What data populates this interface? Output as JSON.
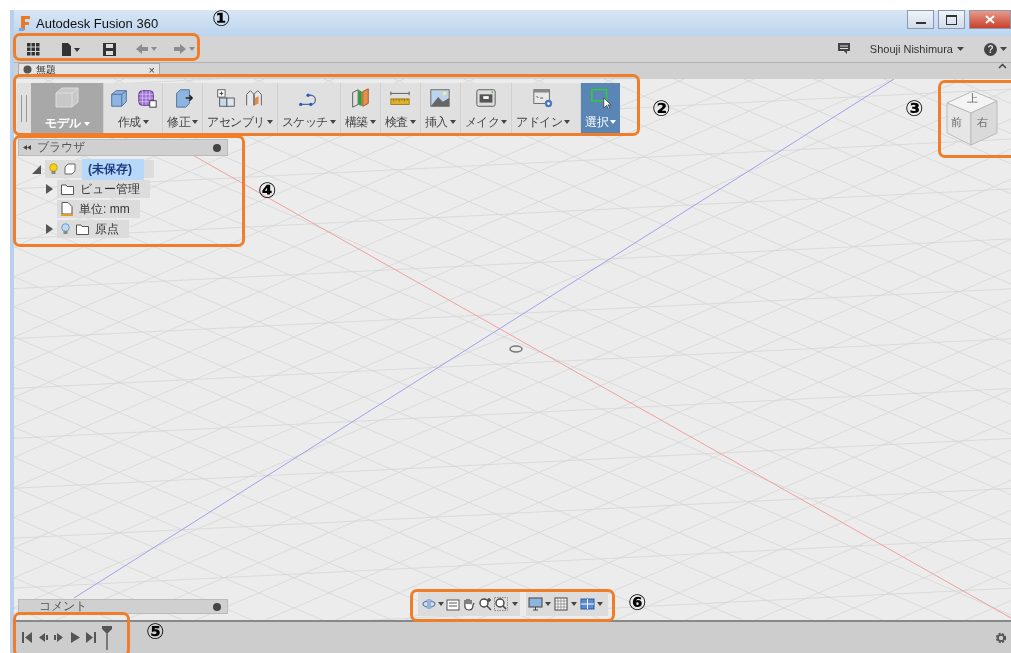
{
  "window": {
    "title": "Autodesk Fusion 360"
  },
  "quick_access": [
    {
      "kind": "apps",
      "disabled": false
    },
    {
      "kind": "file",
      "disabled": false
    },
    {
      "kind": "save",
      "disabled": false
    },
    {
      "kind": "undo",
      "disabled": true
    },
    {
      "kind": "redo",
      "disabled": true
    }
  ],
  "account": {
    "user": "Shouji Nishimura",
    "help": "?"
  },
  "document_tab": {
    "label": "無題",
    "close": "×"
  },
  "ribbon": {
    "workspace": "モデル",
    "groups": [
      {
        "label": "作成",
        "selected": false
      },
      {
        "label": "修正",
        "selected": false
      },
      {
        "label": "アセンブリ",
        "selected": false
      },
      {
        "label": "スケッチ",
        "selected": false
      },
      {
        "label": "構築",
        "selected": false
      },
      {
        "label": "検査",
        "selected": false
      },
      {
        "label": "挿入",
        "selected": false
      },
      {
        "label": "メイク",
        "selected": false
      },
      {
        "label": "アドイン",
        "selected": false
      },
      {
        "label": "選択",
        "selected": true
      }
    ]
  },
  "view_cube": {
    "faces": [
      "上",
      "前",
      "右"
    ]
  },
  "browser": {
    "title": "ブラウザ",
    "tree": [
      {
        "label": "(未保存)",
        "kind": "component",
        "expanded": true,
        "visible": true,
        "selected": true,
        "children": [
          {
            "label": "ビュー管理",
            "kind": "folder",
            "expanded": false,
            "selected": false
          },
          {
            "label": "単位: mm",
            "kind": "units",
            "selected": false
          },
          {
            "label": "原点",
            "kind": "folder",
            "expanded": false,
            "visible": false,
            "selected": false
          }
        ]
      }
    ]
  },
  "comments": {
    "title": "コメント"
  },
  "callouts": [
    "①",
    "②",
    "③",
    "④",
    "⑤",
    "⑥"
  ]
}
